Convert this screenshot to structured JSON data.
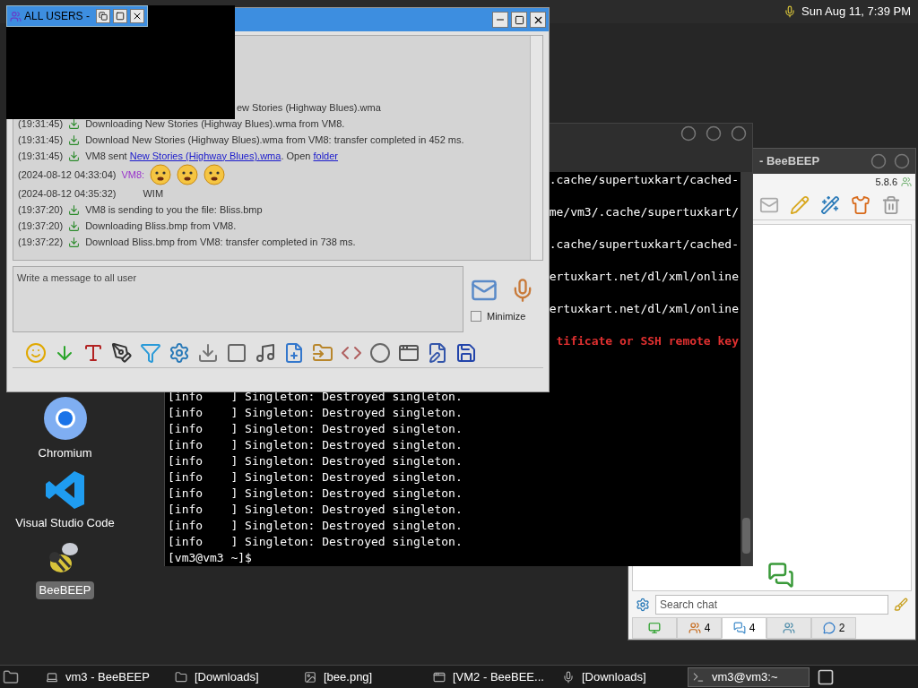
{
  "top_bar": {
    "clock": "Sun Aug 11, 7:39 PM"
  },
  "desktop_icons": [
    {
      "kind": "browser",
      "label": "Chromium",
      "selected": false
    },
    {
      "kind": "editor",
      "label": "Visual Studio Code",
      "selected": false
    },
    {
      "kind": "bee",
      "label": "BeeBEEP",
      "selected": true
    }
  ],
  "mini_window": {
    "title": "ALL USERS -"
  },
  "chat_window": {
    "messages": [
      {
        "kind": "fragment",
        "parts": [
          {
            "text": "ew Stories (Highway Blues).wma"
          }
        ]
      },
      {
        "kind": "file",
        "time": "(19:31:45)",
        "parts": [
          {
            "text": "Downloading New Stories (Highway Blues).wma from VM8."
          }
        ]
      },
      {
        "kind": "file",
        "time": "(19:31:45)",
        "parts": [
          {
            "text": "Download New Stories (Highway Blues).wma from VM8: transfer completed in 452 ms."
          }
        ]
      },
      {
        "kind": "file",
        "time": "(19:31:45)",
        "parts": [
          {
            "text": "VM8 sent "
          },
          {
            "text": "New Stories (Highway Blues).wma",
            "link": true
          },
          {
            "text": ". Open "
          },
          {
            "text": "folder",
            "link": true
          }
        ]
      },
      {
        "kind": "chat",
        "time": "(2024-08-12 04:33:04)",
        "sender": "VM8:",
        "parts": [
          {
            "kind": "emoji"
          },
          {
            "kind": "emoji"
          },
          {
            "kind": "emoji"
          }
        ]
      },
      {
        "kind": "chat",
        "time": "(2024-08-12 04:35:32)",
        "parts": [
          {
            "text": "WIM"
          }
        ]
      },
      {
        "kind": "file",
        "time": "(19:37:20)",
        "parts": [
          {
            "text": "VM8 is sending to you the file: Bliss.bmp"
          }
        ]
      },
      {
        "kind": "file",
        "time": "(19:37:20)",
        "parts": [
          {
            "text": "Downloading Bliss.bmp from VM8."
          }
        ]
      },
      {
        "kind": "file",
        "time": "(19:37:22)",
        "parts": [
          {
            "text": "Download Bliss.bmp from VM8: transfer completed in 738 ms."
          }
        ]
      }
    ],
    "input": {
      "placeholder": "Write a message to all user"
    },
    "minimize": {
      "label": "Minimize",
      "checked": false
    }
  },
  "terminal": {
    "lines": [
      {
        "kind": "fragment",
        "text": ".cache/supertuxkart/cached-"
      },
      {
        "kind": "fragment",
        "text": "me/vm3/.cache/supertuxkart/"
      },
      {
        "kind": "fragment",
        "text": ".cache/supertuxkart/cached-"
      },
      {
        "kind": "fragment",
        "text": "ertuxkart.net/dl/xml/online"
      },
      {
        "kind": "fragment",
        "text": "ertuxkart.net/dl/xml/online"
      },
      {
        "kind": "error",
        "text": "tificate or SSH remote key"
      },
      {
        "kind": "log",
        "text": "[info    ] Singleton: Destroyed singleton."
      },
      {
        "kind": "log",
        "text": "[info    ] Singleton: Destroyed singleton."
      },
      {
        "kind": "log",
        "text": "[info    ] Singleton: Destroyed singleton."
      },
      {
        "kind": "log",
        "text": "[info    ] Singleton: Destroyed singleton."
      },
      {
        "kind": "log",
        "text": "[info    ] Singleton: Destroyed singleton."
      },
      {
        "kind": "log",
        "text": "[info    ] Singleton: Destroyed singleton."
      },
      {
        "kind": "log",
        "text": "[info    ] Singleton: Destroyed singleton."
      },
      {
        "kind": "log",
        "text": "[info    ] Singleton: Destroyed singleton."
      },
      {
        "kind": "log",
        "text": "[info    ] Singleton: Destroyed singleton."
      },
      {
        "kind": "log",
        "text": "[info    ] Singleton: Destroyed singleton."
      },
      {
        "kind": "prompt",
        "text": "[vm3@vm3 ~]$"
      }
    ]
  },
  "beebeep": {
    "title": "- BeeBEEP",
    "version": "5.8.6",
    "search": {
      "placeholder": "Search chat"
    },
    "tabs": [
      {
        "kind": "network",
        "selected": false
      },
      {
        "kind": "users",
        "count": "4",
        "selected": false
      },
      {
        "kind": "chats",
        "count": "4",
        "selected": true
      },
      {
        "kind": "groups",
        "selected": false
      },
      {
        "kind": "shares",
        "count": "2",
        "selected": false
      }
    ]
  },
  "taskbar": {
    "items": [
      {
        "kind": "bee",
        "label": "vm3 - BeeBEEP",
        "selected": false
      },
      {
        "kind": "folder",
        "label": "[Downloads]",
        "selected": false
      },
      {
        "kind": "image",
        "label": "[bee.png]",
        "selected": false
      },
      {
        "kind": "app",
        "label": "[VM2 - BeeBEE...",
        "selected": false
      },
      {
        "kind": "mic",
        "label": "[Downloads]",
        "selected": false
      },
      {
        "kind": "terminal",
        "label": "vm3@vm3:~",
        "selected": true
      }
    ]
  }
}
